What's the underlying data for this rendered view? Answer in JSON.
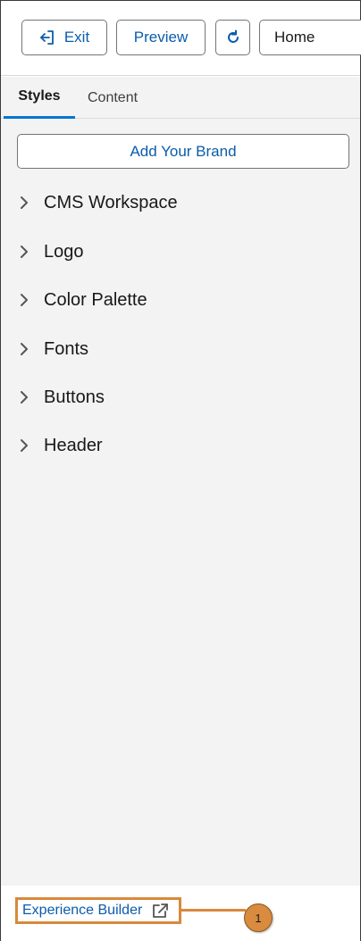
{
  "toolbar": {
    "exit_label": "Exit",
    "preview_label": "Preview",
    "page_selected": "Home"
  },
  "tabs": [
    {
      "label": "Styles",
      "active": true
    },
    {
      "label": "Content",
      "active": false
    }
  ],
  "panel": {
    "add_brand_label": "Add Your Brand",
    "sections": [
      {
        "label": "CMS Workspace",
        "icon": "chevron-right-icon"
      },
      {
        "label": "Logo",
        "icon": "chevron-right-icon"
      },
      {
        "label": "Color Palette",
        "icon": "chevron-right-icon"
      },
      {
        "label": "Fonts",
        "icon": "chevron-right-icon"
      },
      {
        "label": "Buttons",
        "icon": "chevron-right-icon"
      },
      {
        "label": "Header",
        "icon": "chevron-right-icon"
      }
    ]
  },
  "footer": {
    "experience_builder_label": "Experience Builder",
    "callout_number": "1"
  },
  "colors": {
    "accent": "#0b5cab",
    "active_tab": "#0176d3",
    "callout": "#d8893c"
  }
}
